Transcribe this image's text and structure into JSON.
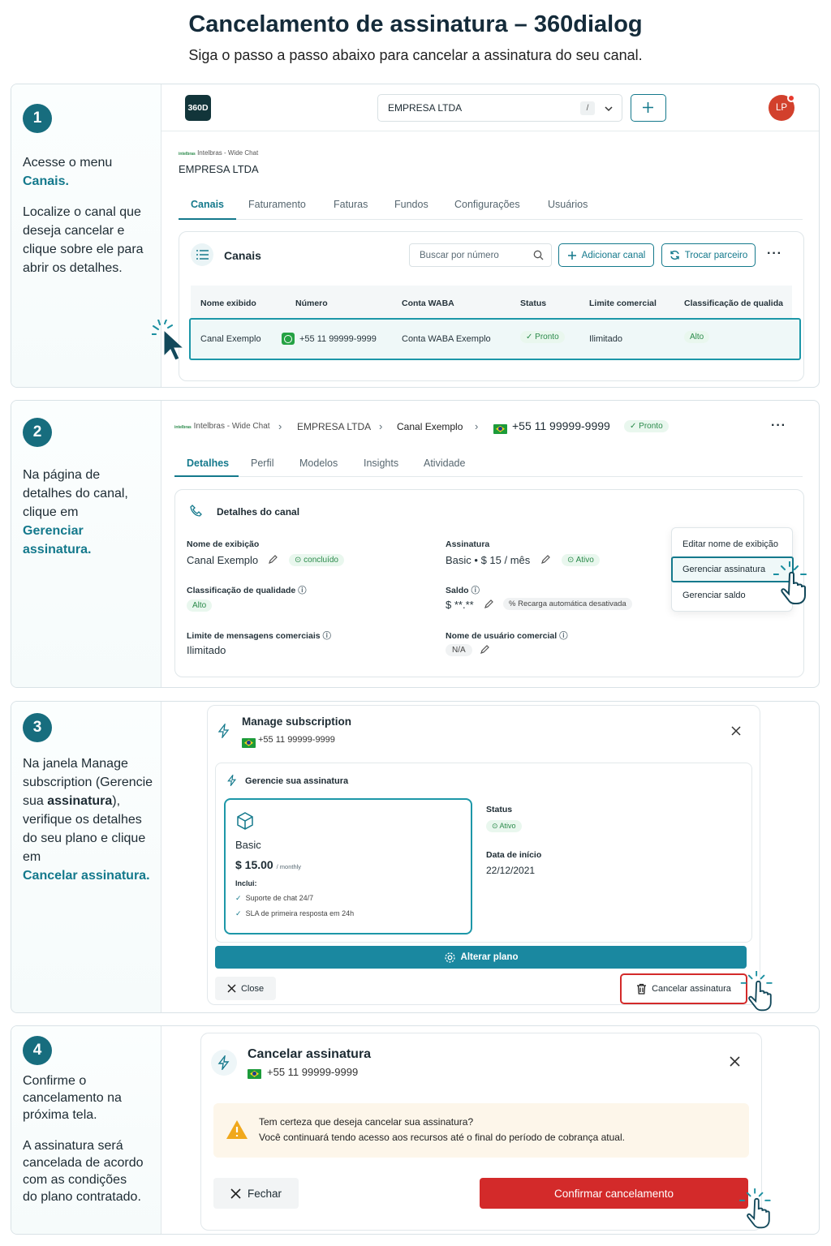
{
  "header": {
    "title": "Cancelamento de assinatura – 360dialog",
    "subtitle": "Siga o passo a passo abaixo para cancelar a assinatura do seu canal."
  },
  "step1": {
    "number": "1",
    "text_a": "Acesse o menu",
    "text_a_hl": "Canais.",
    "text_b": "Localize o canal que deseja cancelar e clique sobre ele para abrir os detalhes.",
    "logo": "360D",
    "company_select": "EMPRESA LTDA",
    "shortcut": "/",
    "avatar": "LP",
    "partner_brand": "Intelbras - Wide Chat",
    "company_name": "EMPRESA LTDA",
    "tabs": [
      "Canais",
      "Faturamento",
      "Faturas",
      "Fundos",
      "Configurações",
      "Usuários"
    ],
    "section_title": "Canais",
    "search_placeholder": "Buscar por número",
    "add_channel": "Adicionar canal",
    "switch_partner": "Trocar parceiro",
    "columns": [
      "Nome exibido",
      "Número",
      "Conta WABA",
      "Status",
      "Limite comercial",
      "Classificação de qualida"
    ],
    "row": {
      "name": "Canal Exemplo",
      "number": "+55 11 99999-9999",
      "waba": "Conta WABA Exemplo",
      "status": "Pronto",
      "limit": "Ilimitado",
      "rating": "Alto"
    }
  },
  "step2": {
    "number": "2",
    "text_a": "Na página de detalhes do canal, clique em",
    "text_hl": "Gerenciar assinatura.",
    "breadcrumb": [
      "Intelbras - Wide Chat",
      "EMPRESA LTDA",
      "Canal Exemplo",
      "+55 11 99999-9999"
    ],
    "status": "Pronto",
    "tabs": [
      "Detalhes",
      "Perfil",
      "Modelos",
      "Insights",
      "Atividade"
    ],
    "card_title": "Detalhes do canal",
    "display_name_label": "Nome de exibição",
    "display_name": "Canal Exemplo",
    "display_name_badge": "concluído",
    "subscription_label": "Assinatura",
    "subscription": "Basic • $ 15 / mês",
    "subscription_badge": "Ativo",
    "quality_label": "Classificação de qualidade",
    "quality": "Alto",
    "balance_label": "Saldo",
    "balance": "$ **.**",
    "recharge": "Recarga automática desativada",
    "limit_label": "Limite de mensagens comerciais",
    "limit": "Ilimitado",
    "username_label": "Nome de usuário comercial",
    "username": "N/A",
    "menu": [
      "Editar nome de exibição",
      "Gerenciar assinatura",
      "Gerenciar saldo"
    ]
  },
  "step3": {
    "number": "3",
    "text_1": "Na janela Manage subscription (Gerencie sua",
    "text_bold": "assinatura",
    "text_2": "), verifique os detalhes do seu plano e clique em",
    "text_hl": "Cancelar assinatura.",
    "modal_title": "Manage subscription",
    "phone": "+55 11 99999-9999",
    "inner_title": "Gerencie sua assinatura",
    "plan_name": "Basic",
    "price": "$ 15.00",
    "price_period": "/ monthly",
    "includes_label": "Inclui:",
    "features": [
      "Suporte de chat 24/7",
      "SLA de primeira resposta em 24h"
    ],
    "status_label": "Status",
    "status": "Ativo",
    "start_label": "Data de início",
    "start_date": "22/12/2021",
    "change_plan": "Alterar plano",
    "close": "Close",
    "cancel": "Cancelar assinatura"
  },
  "step4": {
    "number": "4",
    "text_a": "Confirme o cancelamento na próxima tela.",
    "text_b": "A assinatura será cancelada de acordo com as condições do plano contratado.",
    "modal_title": "Cancelar assinatura",
    "phone": "+55 11 99999-9999",
    "warning_1": "Tem certeza que deseja cancelar sua assinatura?",
    "warning_2": "Você continuará tendo acesso aos recursos até o final do período de cobrança atual.",
    "close": "Fechar",
    "confirm": "Confirmar cancelamento"
  },
  "colors": {
    "accent": "#14798c",
    "danger": "#d32a2a",
    "success": "#2a8a4a",
    "warning": "#f0a81c"
  }
}
